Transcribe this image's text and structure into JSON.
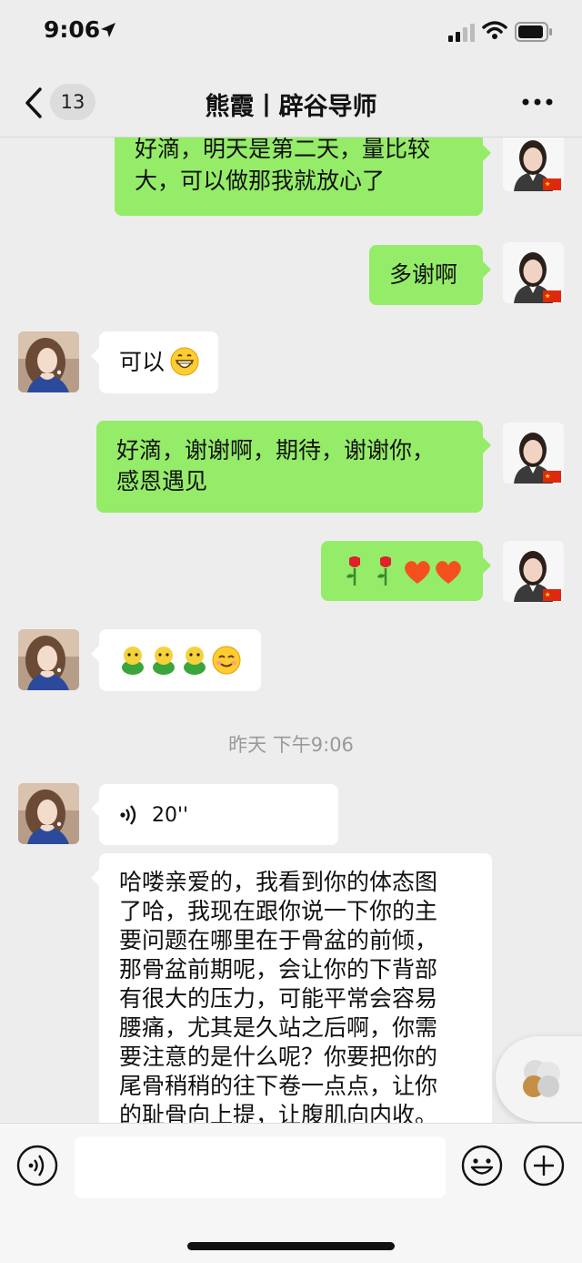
{
  "status_bar": {
    "time": "9:06"
  },
  "header": {
    "unread_count": "13",
    "title": "熊霞丨辟谷导师"
  },
  "messages": [
    {
      "line1": "好滴，明天是第二天，量比较",
      "line2": "大，可以做那我就放心了"
    },
    {
      "text": "多谢啊"
    },
    {
      "text": "可以"
    },
    {
      "line1": "好滴，谢谢啊，期待，谢谢你，",
      "line2": "感恩遇见"
    },
    {
      "emoji": "🌹🌹❤❤"
    },
    {
      "emoji": "😊"
    },
    {
      "voice_duration": "20''"
    },
    {
      "lines": [
        "哈喽亲爱的，我看到你的体态图",
        "了哈，我现在跟你说一下你的主",
        "要问题在哪里在于骨盆的前倾，",
        "那骨盆前期呢，会让你的下背部",
        "有很大的压力，可能平常会容易",
        "腰痛，尤其是久站之后啊，你需",
        "要注意的是什么呢？你要把你的",
        "尾骨稍稍的往下卷一点点，让你",
        "的耻骨向上提，让腹肌向内收。"
      ]
    }
  ],
  "timestamp": "昨天 下午9:06",
  "input": {
    "value": ""
  }
}
